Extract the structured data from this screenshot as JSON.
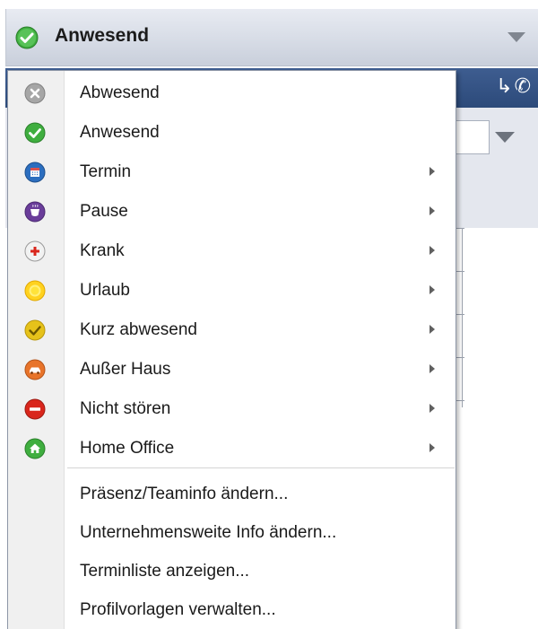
{
  "header": {
    "status_label": "Anwesend",
    "status_icon": "check-green-icon",
    "dropdown_icon": "chevron-down-icon"
  },
  "toolbar": {
    "icons": [
      "forward-icon",
      "phone-icon"
    ]
  },
  "menu": {
    "status_items": [
      {
        "label": "Abwesend",
        "icon": "absent-x-icon",
        "submenu": false
      },
      {
        "label": "Anwesend",
        "icon": "present-check-icon",
        "submenu": false
      },
      {
        "label": "Termin",
        "icon": "calendar-icon",
        "submenu": true
      },
      {
        "label": "Pause",
        "icon": "coffee-cup-icon",
        "submenu": true
      },
      {
        "label": "Krank",
        "icon": "medical-cross-icon",
        "submenu": true
      },
      {
        "label": "Urlaub",
        "icon": "sun-icon",
        "submenu": true
      },
      {
        "label": "Kurz abwesend",
        "icon": "short-absence-check-icon",
        "submenu": true
      },
      {
        "label": "Außer Haus",
        "icon": "car-icon",
        "submenu": true
      },
      {
        "label": "Nicht stören",
        "icon": "do-not-disturb-icon",
        "submenu": true
      },
      {
        "label": "Home Office",
        "icon": "home-icon",
        "submenu": true
      }
    ],
    "action_items": [
      {
        "label": "Präsenz/Teaminfo ändern..."
      },
      {
        "label": "Unternehmensweite Info ändern..."
      },
      {
        "label": "Terminliste anzeigen..."
      },
      {
        "label": "Profilvorlagen verwalten..."
      }
    ]
  },
  "colors": {
    "header_bg": "#d7dce6",
    "toolbar_bg": "#2c4a7a",
    "menu_gutter": "#f0f0f0",
    "present_green": "#3fae3f",
    "absent_gray": "#9a9a9a"
  }
}
